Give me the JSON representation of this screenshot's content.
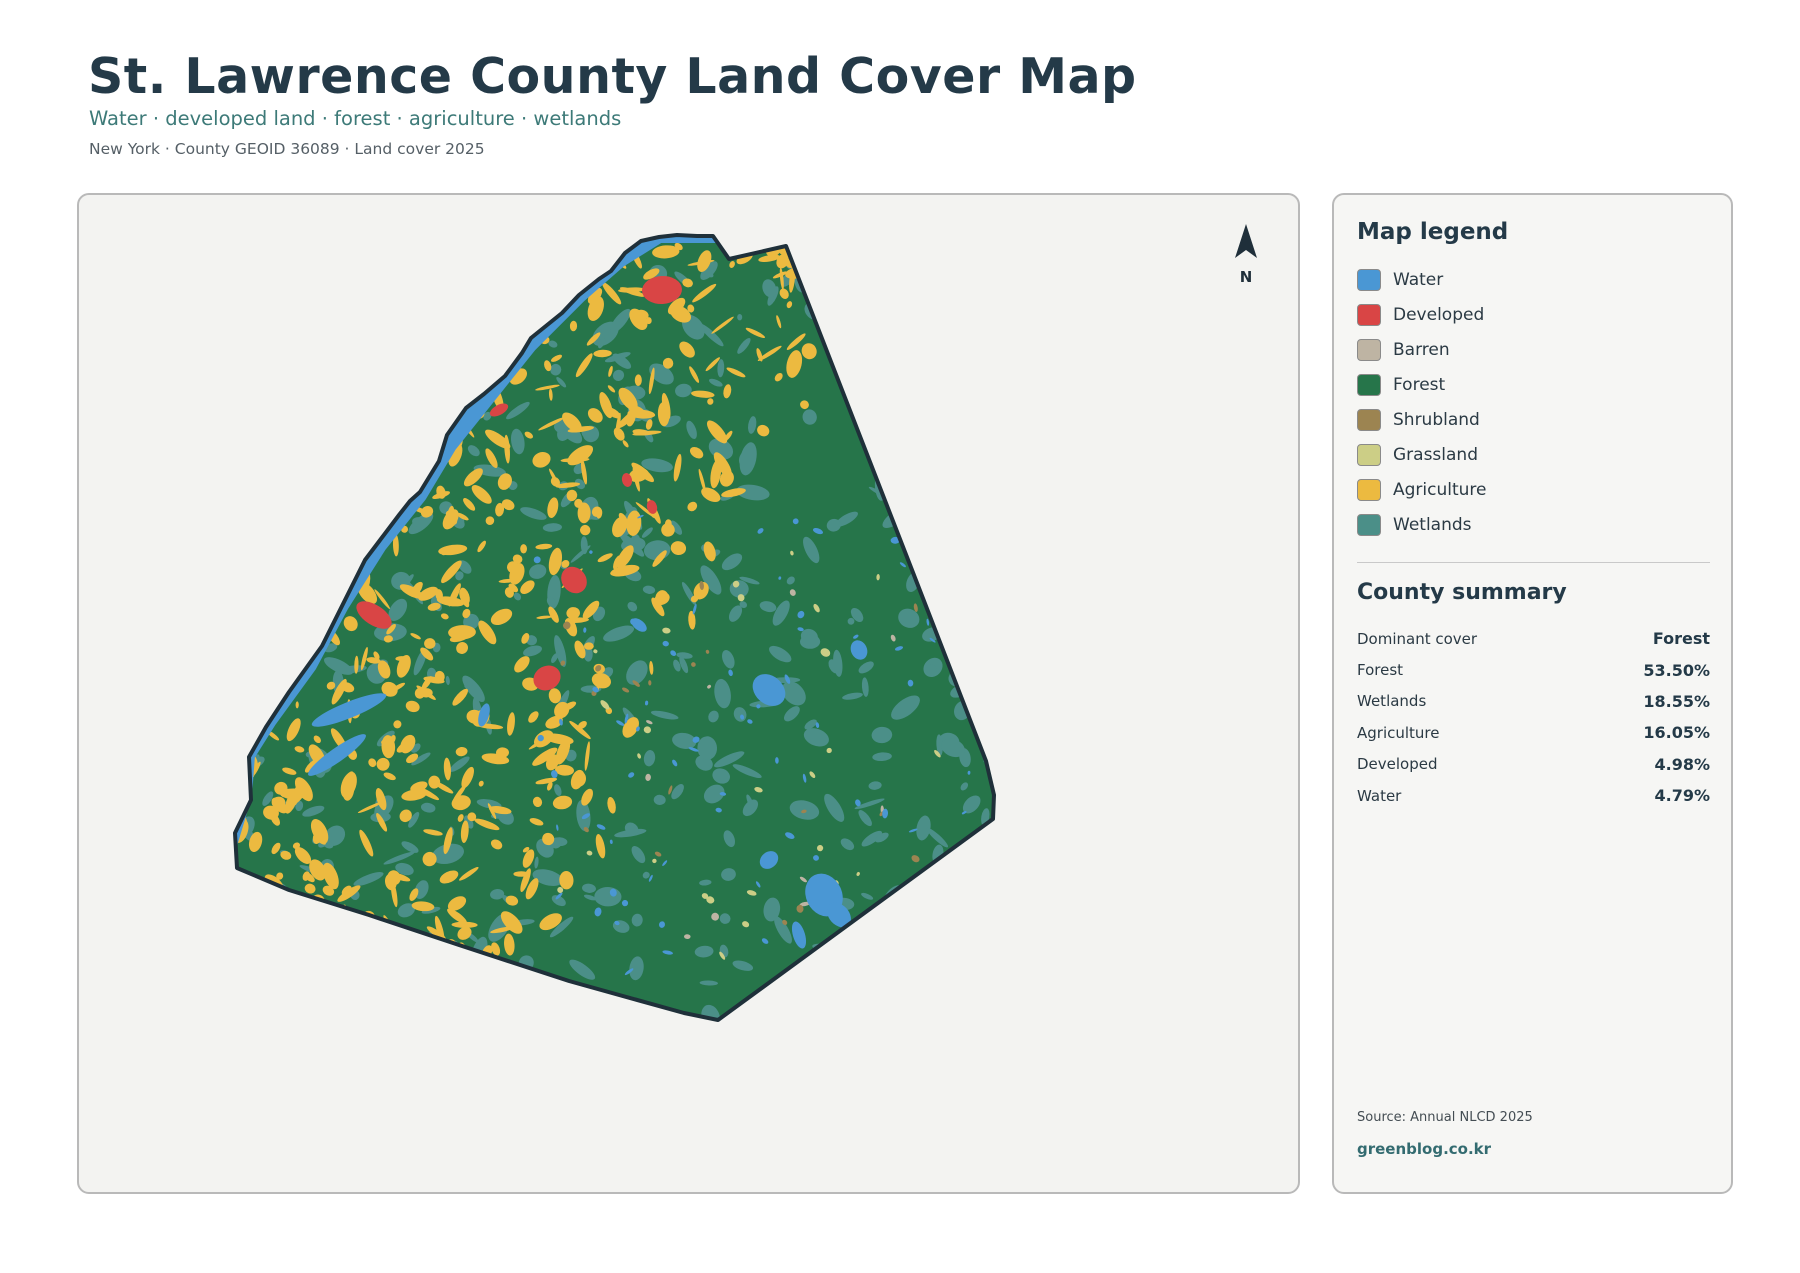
{
  "header": {
    "title": "St. Lawrence County Land Cover Map",
    "subtitle": "Water · developed land · forest · agriculture · wetlands",
    "meta": "New York · County GEOID 36089 · Land cover 2025"
  },
  "map": {
    "north_label": "N",
    "north_icon": "north-arrow-icon",
    "colors": {
      "Water": "#4a97d4",
      "Developed": "#d94545",
      "Barren": "#beb4a3",
      "Forest": "#26754a",
      "Shrubland": "#9c8451",
      "Grassland": "#ccce86",
      "Agriculture": "#ecba40",
      "Wetlands": "#4b8f88",
      "boundary": "#1f303a"
    }
  },
  "legend": {
    "title": "Map legend",
    "items": [
      {
        "label": "Water",
        "color": "#4a97d4"
      },
      {
        "label": "Developed",
        "color": "#d94545"
      },
      {
        "label": "Barren",
        "color": "#beb4a3"
      },
      {
        "label": "Forest",
        "color": "#26754a"
      },
      {
        "label": "Shrubland",
        "color": "#9c8451"
      },
      {
        "label": "Grassland",
        "color": "#ccce86"
      },
      {
        "label": "Agriculture",
        "color": "#ecba40"
      },
      {
        "label": "Wetlands",
        "color": "#4b8f88"
      }
    ]
  },
  "summary": {
    "title": "County summary",
    "rows": [
      {
        "key": "Dominant cover",
        "value": "Forest"
      },
      {
        "key": "Forest",
        "value": "53.50%"
      },
      {
        "key": "Wetlands",
        "value": "18.55%"
      },
      {
        "key": "Agriculture",
        "value": "16.05%"
      },
      {
        "key": "Developed",
        "value": "4.98%"
      },
      {
        "key": "Water",
        "value": "4.79%"
      }
    ]
  },
  "footer": {
    "source": "Source: Annual NLCD 2025",
    "site": "greenblog.co.kr"
  }
}
